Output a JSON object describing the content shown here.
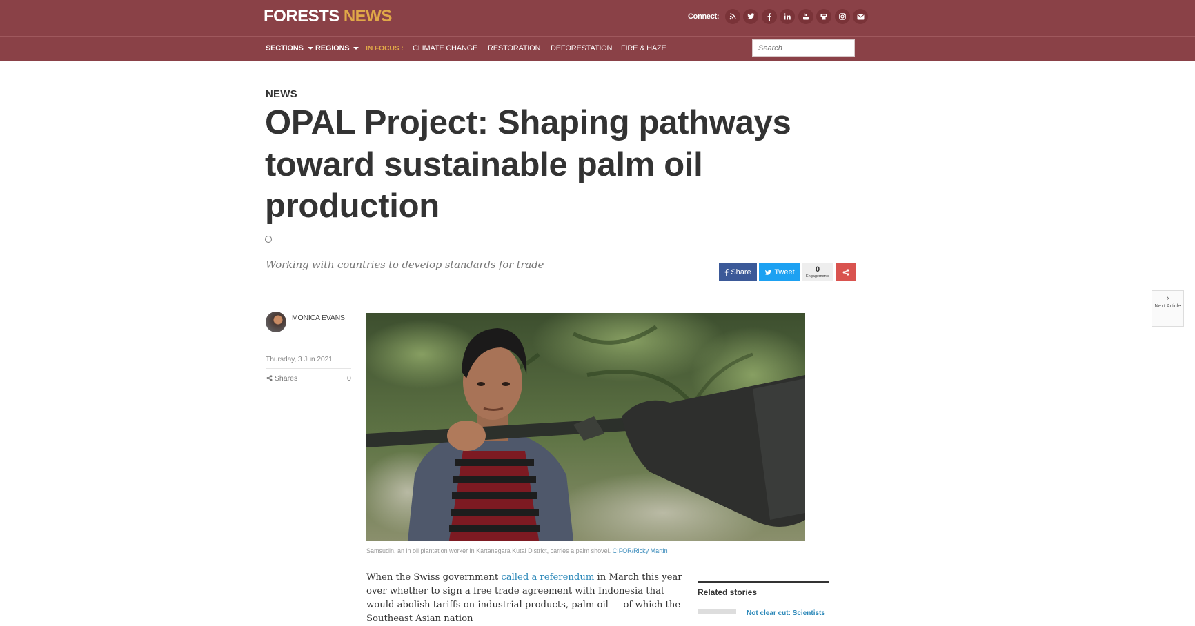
{
  "header": {
    "logo_main": "FORESTS",
    "logo_accent": "NEWS",
    "connect_label": "Connect:",
    "social_icons": [
      "rss-icon",
      "twitter-icon",
      "facebook-icon",
      "linkedin-icon",
      "youtube-icon",
      "podcast-icon",
      "instagram-icon",
      "email-icon"
    ]
  },
  "nav": {
    "sections": "SECTIONS",
    "regions": "REGIONS",
    "in_focus": "IN FOCUS :",
    "items": [
      "CLIMATE CHANGE",
      "RESTORATION",
      "DEFORESTATION",
      "FIRE & HAZE"
    ],
    "search_placeholder": "Search"
  },
  "article": {
    "kicker": "NEWS",
    "title": "OPAL Project: Shaping pathways toward sustainable palm oil production",
    "subtitle": "Working with countries to develop standards for trade",
    "author": "MONICA EVANS",
    "date": "Thursday, 3 Jun 2021",
    "shares_label": "Shares",
    "shares_count": "0",
    "caption": "Samsudin, an in oil plantation worker in Kartanegara Kutai District, carries a palm shovel.",
    "caption_credit": "CIFOR/Ricky Martin",
    "body_before_link": "When the Swiss government ",
    "body_link": "called a referendum",
    "body_after_link": " in March this year over whether to sign a free trade agreement with Indonesia that would abolish tariffs on industrial products, palm oil — of which the Southeast Asian nation"
  },
  "share": {
    "facebook": "Share",
    "twitter": "Tweet",
    "engagements_count": "0",
    "engagements_label": "Engagements"
  },
  "related": {
    "title": "Related stories",
    "first_link": "Not clear cut: Scientists"
  },
  "next_article": "Next Article",
  "colors": {
    "brand": "#8a4147",
    "accent": "#e0a848",
    "facebook": "#3b5998",
    "twitter": "#1da1f2",
    "share_red": "#d9534f",
    "link": "#2a87b8"
  }
}
